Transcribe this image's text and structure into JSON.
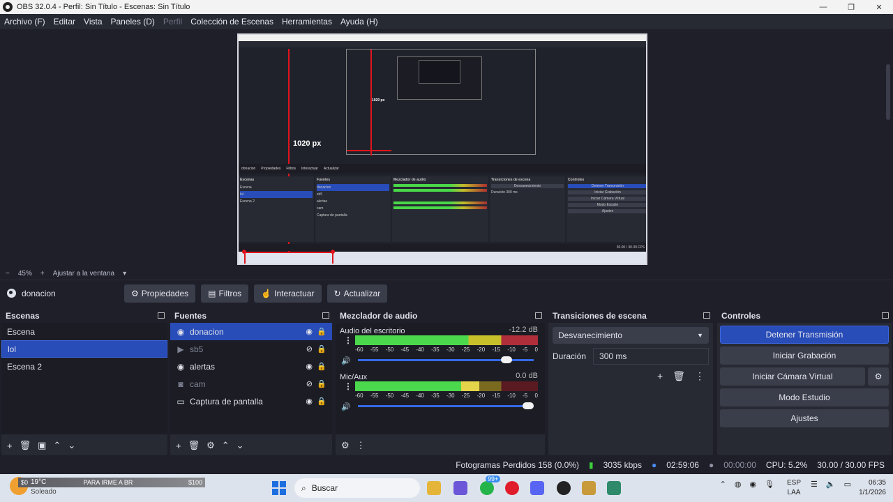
{
  "window": {
    "title": "OBS 32.0.4 - Perfil: Sin Título - Escenas: Sin Título",
    "minimize": "—",
    "maximize": "❐",
    "close": "✕"
  },
  "menu": [
    "Archivo (F)",
    "Editar",
    "Vista",
    "Paneles (D)",
    "Perfil",
    "Colección de Escenas",
    "Herramientas",
    "Ayuda (H)"
  ],
  "preview": {
    "measure_label": "1020 px",
    "zoom_minus": "−",
    "zoom_value": "45%",
    "zoom_plus": "+",
    "zoom_fit": "Ajustar a la ventana"
  },
  "source_toolbar": {
    "source_name": "donacion",
    "buttons": [
      "Propiedades",
      "Filtros",
      "Interactuar",
      "Actualizar"
    ]
  },
  "scenes": {
    "title": "Escenas",
    "items": [
      "Escena",
      "lol",
      "Escena 2"
    ],
    "selected": "lol"
  },
  "sources": {
    "title": "Fuentes",
    "items": [
      {
        "name": "donacion",
        "icon": "globe-icon",
        "visible": true
      },
      {
        "name": "sb5",
        "icon": "play-icon",
        "visible": false
      },
      {
        "name": "alertas",
        "icon": "globe-icon",
        "visible": true
      },
      {
        "name": "cam",
        "icon": "camera-icon",
        "visible": false
      },
      {
        "name": "Captura de pantalla",
        "icon": "monitor-icon",
        "visible": true
      }
    ]
  },
  "mixer": {
    "title": "Mezclador de audio",
    "channels": [
      {
        "name": "Audio del escritorio",
        "db": "-12.2 dB",
        "volume": 0.87
      },
      {
        "name": "Mic/Aux",
        "db": "0.0 dB",
        "volume": 1.0
      }
    ],
    "scale": [
      "-60",
      "-55",
      "-50",
      "-45",
      "-40",
      "-35",
      "-30",
      "-25",
      "-20",
      "-15",
      "-10",
      "-5",
      "0"
    ]
  },
  "transitions": {
    "title": "Transiciones de escena",
    "selected": "Desvanecimiento",
    "duration_label": "Duración",
    "duration_value": "300 ms"
  },
  "controls": {
    "title": "Controles",
    "buttons": [
      "Detener Transmisión",
      "Iniciar Grabación",
      "Iniciar Cámara Virtual",
      "Modo Estudio",
      "Ajustes"
    ]
  },
  "status": {
    "dropped": "Fotogramas Perdidos 158 (0.0%)",
    "bitrate": "3035 kbps",
    "stream_time": "02:59:06",
    "rec_time": "00:00:00",
    "cpu": "CPU: 5.2%",
    "fps": "30.00 / 30.00 FPS"
  },
  "taskbar": {
    "weather_temp": "19°C",
    "weather_desc": "Soleado",
    "donation_left": "$0",
    "donation_text": "PARA IRME A BR",
    "donation_right": "$100",
    "search": "Buscar",
    "lang_top": "ESP",
    "lang_bottom": "LAA",
    "time": "06:35",
    "date": "1/1/2026",
    "badge": "99+"
  },
  "colors": {
    "accent": "#284cb8",
    "record_red": "#e0141c",
    "meter_green": "#4cd84c"
  }
}
